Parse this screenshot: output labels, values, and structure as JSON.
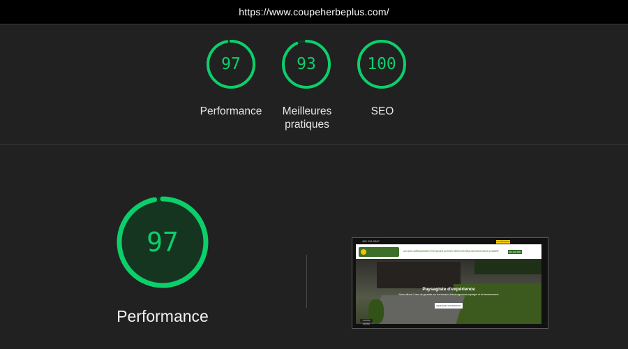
{
  "url": "https://www.coupeherbeplus.com/",
  "colors": {
    "accent": "#0ccf6b",
    "track": "#113a22",
    "background": "#212121"
  },
  "scores": [
    {
      "value": 97,
      "label": "Performance"
    },
    {
      "value": 93,
      "label": "Meilleures pratiques"
    },
    {
      "value": 100,
      "label": "SEO"
    }
  ],
  "main": {
    "value": 97,
    "label": "Performance"
  },
  "thumbnail": {
    "phone": "450 234-5367",
    "top_button": "SOUMISSION",
    "menu": "ACCUEIL   AMÉNAGEMENT PAYSAGER   AUTRES SERVICES   RÉALISATIONS   NOUS JOINDRE",
    "nav_button": "450 234-5367",
    "title": "Paysagiste d'expérience",
    "subtitle": "Nous offrons 3 ans de garantie sur les travaux d'aménagement paysager et de terrassement",
    "button": "DEMANDE SOUMISSION",
    "badge": "COUPE HERBE"
  }
}
